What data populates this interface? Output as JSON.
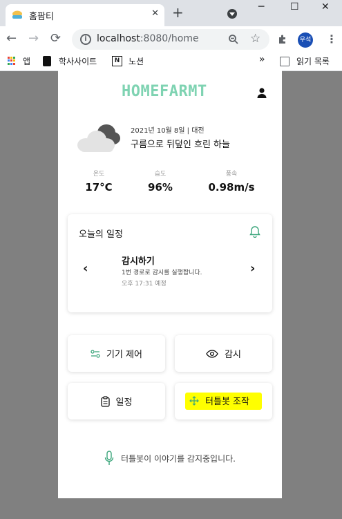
{
  "browser": {
    "tab_title": "홈팜티",
    "tab_close": "✕",
    "new_tab": "+",
    "window_controls": {
      "minimize": "─",
      "maximize": "☐",
      "close": "✕"
    },
    "nav": {
      "back": "←",
      "forward": "→",
      "reload": "⟳"
    },
    "url_host": "localhost",
    "url_rest": ":8080/home",
    "profile_label": "우석",
    "bookmarks": {
      "apps": "앱",
      "academic": "학사사이트",
      "notion": "노션",
      "more": "»",
      "reading_list": "읽기 목록"
    }
  },
  "app": {
    "logo": "HOMEFARMT",
    "weather": {
      "date": "2021년 10월 8일 | 대전",
      "description": "구름으로 뒤덮인 흐린 하늘",
      "stats": [
        {
          "label": "온도",
          "value": "17°C"
        },
        {
          "label": "습도",
          "value": "96%"
        },
        {
          "label": "풍속",
          "value": "0.98m/s"
        }
      ]
    },
    "schedule": {
      "title": "오늘의 일정",
      "prev": "‹",
      "next": "›",
      "event_title": "감시하기",
      "event_desc": "1번 경로로 감시를 실행합니다.",
      "event_time": "오후 17:31 예정"
    },
    "buttons": {
      "device_control": "기기 제어",
      "monitor": "감시",
      "schedule": "일정",
      "turtlebot": "터틀봇 조작"
    },
    "voice_status": "터틀봇이 이야기를 감지중입니다.",
    "colors": {
      "accent": "#7fd3b2",
      "highlight": "#ffff00",
      "icon_green": "#3aa57a"
    }
  }
}
